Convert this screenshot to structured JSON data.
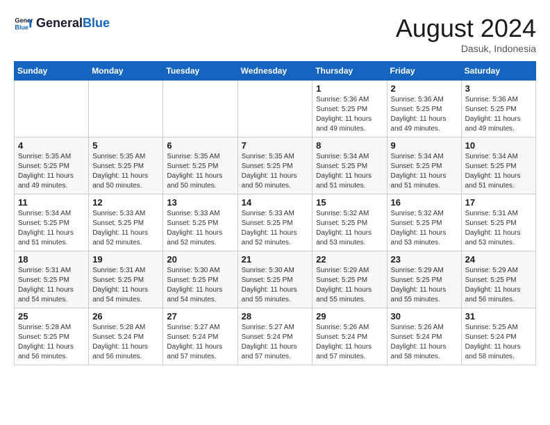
{
  "header": {
    "logo_line1": "General",
    "logo_line2": "Blue",
    "title": "August 2024",
    "subtitle": "Dasuk, Indonesia"
  },
  "days_of_week": [
    "Sunday",
    "Monday",
    "Tuesday",
    "Wednesday",
    "Thursday",
    "Friday",
    "Saturday"
  ],
  "weeks": [
    [
      {
        "day": "",
        "info": ""
      },
      {
        "day": "",
        "info": ""
      },
      {
        "day": "",
        "info": ""
      },
      {
        "day": "",
        "info": ""
      },
      {
        "day": "1",
        "info": "Sunrise: 5:36 AM\nSunset: 5:25 PM\nDaylight: 11 hours and 49 minutes."
      },
      {
        "day": "2",
        "info": "Sunrise: 5:36 AM\nSunset: 5:25 PM\nDaylight: 11 hours and 49 minutes."
      },
      {
        "day": "3",
        "info": "Sunrise: 5:36 AM\nSunset: 5:25 PM\nDaylight: 11 hours and 49 minutes."
      }
    ],
    [
      {
        "day": "4",
        "info": "Sunrise: 5:35 AM\nSunset: 5:25 PM\nDaylight: 11 hours and 49 minutes."
      },
      {
        "day": "5",
        "info": "Sunrise: 5:35 AM\nSunset: 5:25 PM\nDaylight: 11 hours and 50 minutes."
      },
      {
        "day": "6",
        "info": "Sunrise: 5:35 AM\nSunset: 5:25 PM\nDaylight: 11 hours and 50 minutes."
      },
      {
        "day": "7",
        "info": "Sunrise: 5:35 AM\nSunset: 5:25 PM\nDaylight: 11 hours and 50 minutes."
      },
      {
        "day": "8",
        "info": "Sunrise: 5:34 AM\nSunset: 5:25 PM\nDaylight: 11 hours and 51 minutes."
      },
      {
        "day": "9",
        "info": "Sunrise: 5:34 AM\nSunset: 5:25 PM\nDaylight: 11 hours and 51 minutes."
      },
      {
        "day": "10",
        "info": "Sunrise: 5:34 AM\nSunset: 5:25 PM\nDaylight: 11 hours and 51 minutes."
      }
    ],
    [
      {
        "day": "11",
        "info": "Sunrise: 5:34 AM\nSunset: 5:25 PM\nDaylight: 11 hours and 51 minutes."
      },
      {
        "day": "12",
        "info": "Sunrise: 5:33 AM\nSunset: 5:25 PM\nDaylight: 11 hours and 52 minutes."
      },
      {
        "day": "13",
        "info": "Sunrise: 5:33 AM\nSunset: 5:25 PM\nDaylight: 11 hours and 52 minutes."
      },
      {
        "day": "14",
        "info": "Sunrise: 5:33 AM\nSunset: 5:25 PM\nDaylight: 11 hours and 52 minutes."
      },
      {
        "day": "15",
        "info": "Sunrise: 5:32 AM\nSunset: 5:25 PM\nDaylight: 11 hours and 53 minutes."
      },
      {
        "day": "16",
        "info": "Sunrise: 5:32 AM\nSunset: 5:25 PM\nDaylight: 11 hours and 53 minutes."
      },
      {
        "day": "17",
        "info": "Sunrise: 5:31 AM\nSunset: 5:25 PM\nDaylight: 11 hours and 53 minutes."
      }
    ],
    [
      {
        "day": "18",
        "info": "Sunrise: 5:31 AM\nSunset: 5:25 PM\nDaylight: 11 hours and 54 minutes."
      },
      {
        "day": "19",
        "info": "Sunrise: 5:31 AM\nSunset: 5:25 PM\nDaylight: 11 hours and 54 minutes."
      },
      {
        "day": "20",
        "info": "Sunrise: 5:30 AM\nSunset: 5:25 PM\nDaylight: 11 hours and 54 minutes."
      },
      {
        "day": "21",
        "info": "Sunrise: 5:30 AM\nSunset: 5:25 PM\nDaylight: 11 hours and 55 minutes."
      },
      {
        "day": "22",
        "info": "Sunrise: 5:29 AM\nSunset: 5:25 PM\nDaylight: 11 hours and 55 minutes."
      },
      {
        "day": "23",
        "info": "Sunrise: 5:29 AM\nSunset: 5:25 PM\nDaylight: 11 hours and 55 minutes."
      },
      {
        "day": "24",
        "info": "Sunrise: 5:29 AM\nSunset: 5:25 PM\nDaylight: 11 hours and 56 minutes."
      }
    ],
    [
      {
        "day": "25",
        "info": "Sunrise: 5:28 AM\nSunset: 5:25 PM\nDaylight: 11 hours and 56 minutes."
      },
      {
        "day": "26",
        "info": "Sunrise: 5:28 AM\nSunset: 5:24 PM\nDaylight: 11 hours and 56 minutes."
      },
      {
        "day": "27",
        "info": "Sunrise: 5:27 AM\nSunset: 5:24 PM\nDaylight: 11 hours and 57 minutes."
      },
      {
        "day": "28",
        "info": "Sunrise: 5:27 AM\nSunset: 5:24 PM\nDaylight: 11 hours and 57 minutes."
      },
      {
        "day": "29",
        "info": "Sunrise: 5:26 AM\nSunset: 5:24 PM\nDaylight: 11 hours and 57 minutes."
      },
      {
        "day": "30",
        "info": "Sunrise: 5:26 AM\nSunset: 5:24 PM\nDaylight: 11 hours and 58 minutes."
      },
      {
        "day": "31",
        "info": "Sunrise: 5:25 AM\nSunset: 5:24 PM\nDaylight: 11 hours and 58 minutes."
      }
    ]
  ]
}
